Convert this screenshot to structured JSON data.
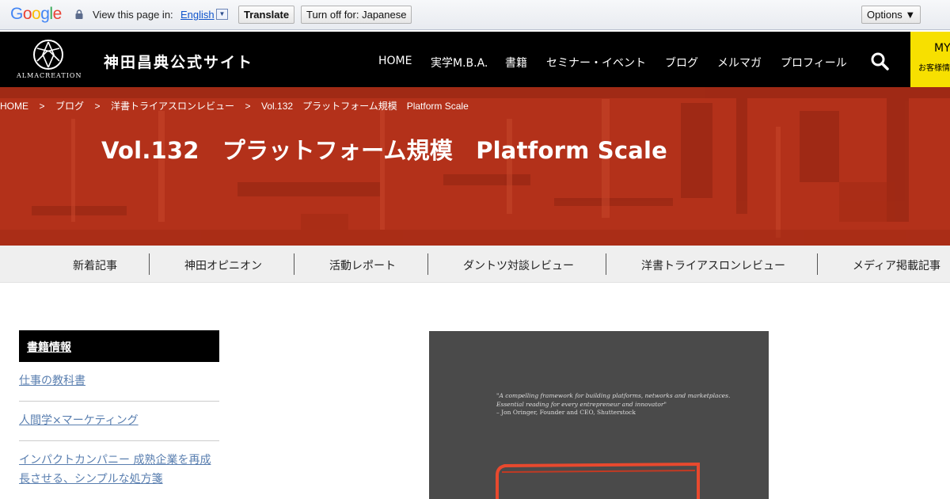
{
  "translate_bar": {
    "logo": "Google",
    "view_text": "View this page in:",
    "language": "English",
    "translate_label": "Translate",
    "turn_off_label": "Turn off for: Japanese",
    "options_label": "Options ▼"
  },
  "header": {
    "logo_text": "ALMACREATION",
    "site_title": "神田昌典公式サイト",
    "nav": [
      "HOME",
      "実学M.B.A.",
      "書籍",
      "セミナー・イベント",
      "ブログ",
      "メルマガ",
      "プロフィール"
    ],
    "my_label": "MY",
    "my_sub": "お客様情"
  },
  "breadcrumb": [
    "HOME",
    "ブログ",
    "洋書トライアスロンレビュー",
    "Vol.132　プラットフォーム規模　Platform Scale"
  ],
  "breadcrumb_sep": ">",
  "hero": {
    "title": "Vol.132　プラットフォーム規模　Platform Scale",
    "accent_color": "#b3311a"
  },
  "categories": [
    "新着記事",
    "神田オピニオン",
    "活動レポート",
    "ダントツ対談レビュー",
    "洋書トライアスロンレビュー",
    "メディア掲載記事"
  ],
  "sidebar": {
    "heading": "書籍情報",
    "items": [
      "仕事の教科書",
      "人間学×マーケティング",
      "インパクトカンパニー 成熟企業を再成長させる、シンプルな処方箋"
    ]
  },
  "book": {
    "quote": "\"A compelling framework for building platforms, networks and marketplaces.\nEssential reading for every entrepreneur and innovator\"",
    "quote_author": "– Jon Oringer, Founder and CEO, Shutterstock"
  }
}
